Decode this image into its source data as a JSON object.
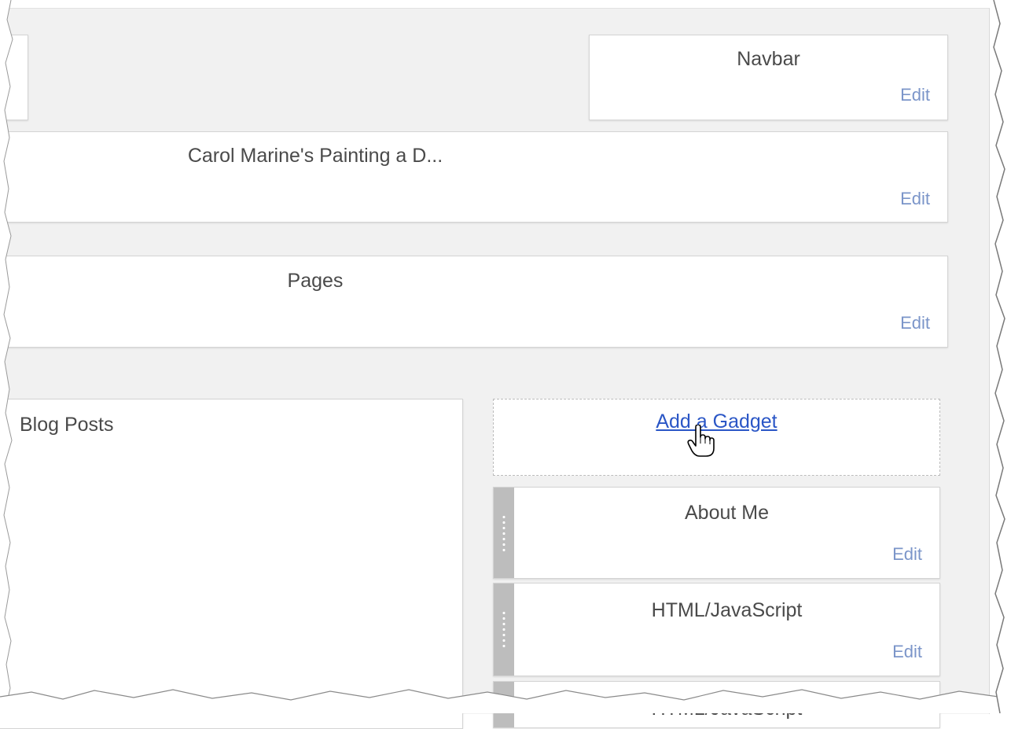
{
  "layout_editor": {
    "navbar": {
      "title": "Navbar",
      "edit": "Edit"
    },
    "header": {
      "title": "Carol Marine's Painting a D...",
      "edit": "Edit"
    },
    "pages": {
      "title": "Pages",
      "edit": "Edit"
    },
    "blog_posts": {
      "title": "Blog Posts"
    },
    "sidebar": {
      "add_gadget": "Add a Gadget",
      "gadgets": [
        {
          "title": "About Me",
          "edit": "Edit"
        },
        {
          "title": "HTML/JavaScript",
          "edit": "Edit"
        },
        {
          "title": "HTML/JavaScript"
        }
      ]
    }
  },
  "colors": {
    "canvas_bg": "#f1f1f1",
    "edit_link": "#7b95c9",
    "add_gadget_link": "#2a56c6",
    "handle": "#bdbdbd"
  },
  "cursor_icon": "pointer-hand-icon"
}
